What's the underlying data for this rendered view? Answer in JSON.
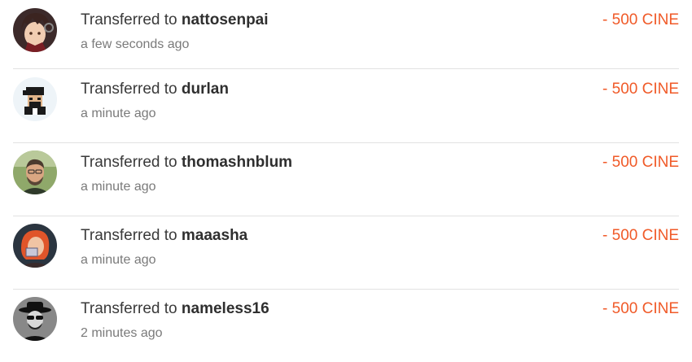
{
  "transactions": [
    {
      "prefix": "Transferred to ",
      "user": "nattosenpai",
      "time": "a few seconds ago",
      "amount": "- 500 CINE"
    },
    {
      "prefix": "Transferred to ",
      "user": "durlan",
      "time": "a minute ago",
      "amount": "- 500 CINE"
    },
    {
      "prefix": "Transferred to ",
      "user": "thomashnblum",
      "time": "a minute ago",
      "amount": "- 500 CINE"
    },
    {
      "prefix": "Transferred to ",
      "user": "maaasha",
      "time": "a minute ago",
      "amount": "- 500 CINE"
    },
    {
      "prefix": "Transferred to ",
      "user": "nameless16",
      "time": "2 minutes ago",
      "amount": "- 500 CINE"
    }
  ],
  "colors": {
    "amount": "#f05a28",
    "divider": "#e2e2e2",
    "time": "#7a7a7a"
  }
}
